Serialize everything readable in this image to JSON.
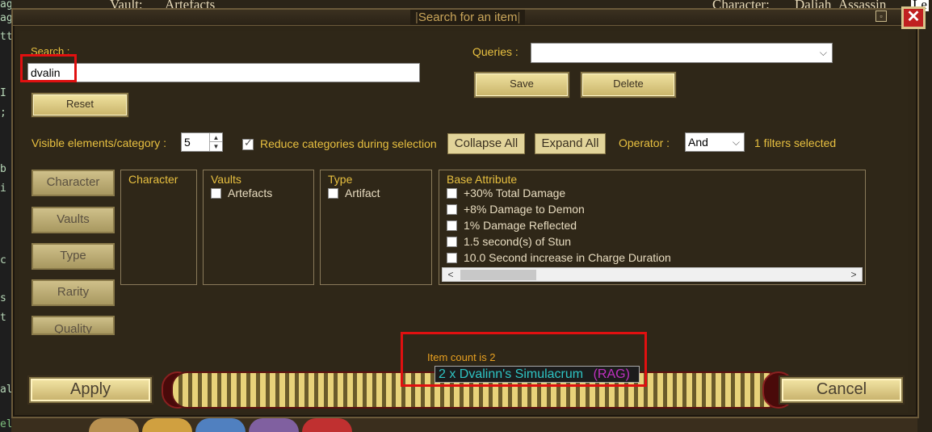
{
  "background": {
    "vault_label": "Vault:",
    "vault_value": "Artefacts",
    "character_label": "Character:",
    "character_value": "Daliah_Assassin",
    "right_cut": "Le",
    "left_code": [
      "ageBC",
      "ag",
      "tt",
      "I",
      ";",
      "b",
      "i",
      "c",
      "s",
      "t",
      "al",
      "elect"
    ]
  },
  "dialog": {
    "title": "Search for an item",
    "close_glyph": "✕",
    "minimize_glyph": "▫"
  },
  "search": {
    "label": "Search :",
    "value": "dvalin",
    "reset_label": "Reset"
  },
  "queries": {
    "label": "Queries :",
    "value": "",
    "save_label": "Save",
    "delete_label": "Delete"
  },
  "filters": {
    "visible_label": "Visible elements/category :",
    "visible_value": "5",
    "reduce_label": "Reduce categories during selection",
    "reduce_checked": true,
    "collapse_label": "Collapse All",
    "expand_label": "Expand All",
    "operator_label": "Operator :",
    "operator_value": "And",
    "filters_selected": "1 filters selected"
  },
  "tabs": [
    "Character",
    "Vaults",
    "Type",
    "Rarity",
    "Quality"
  ],
  "panels": {
    "character": {
      "header": "Character"
    },
    "vaults": {
      "header": "Vaults",
      "items": [
        "Artefacts"
      ]
    },
    "type": {
      "header": "Type",
      "items": [
        "Artifact"
      ]
    },
    "base_attribute": {
      "header": "Base Attribute",
      "items": [
        "+30% Total Damage",
        "+8% Damage to Demon",
        "1% Damage Reflected",
        "1.5 second(s) of Stun",
        "10.0 Second increase in Charge Duration"
      ]
    }
  },
  "results": {
    "count_text": "Item count is 2",
    "item_name": "2 x Dvalinn's Simulacrum",
    "item_tag": "(RAG)"
  },
  "footer": {
    "apply_label": "Apply",
    "cancel_label": "Cancel"
  },
  "colors": {
    "accent_gold": "#e8c040",
    "highlight_red": "#e01010",
    "item_cyan": "#2ec4c4",
    "item_purple": "#c030c0"
  }
}
